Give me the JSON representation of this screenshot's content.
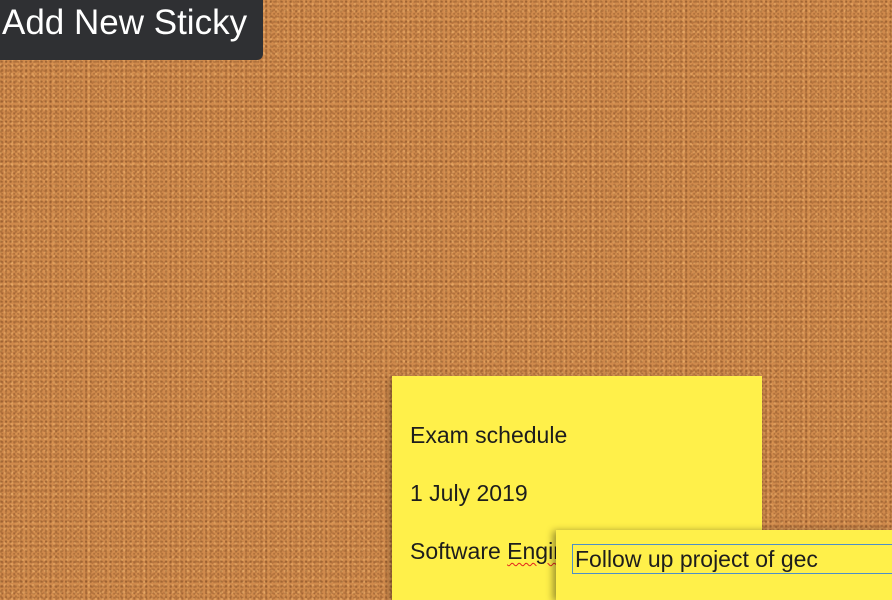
{
  "toolbar": {
    "add_button_label": "Add New Sticky"
  },
  "notes": [
    {
      "lines": [
        "Exam schedule",
        "1 July 2019",
        "Software "
      ],
      "misspelled_word": "Enginner"
    },
    {
      "value": "Follow up project of gec"
    }
  ],
  "colors": {
    "board": "#cf8a4c",
    "sticky": "#fff04a",
    "button_bg": "#2f3033",
    "button_text": "#ffffff",
    "focus_border": "#4d8fc7",
    "spellcheck": "#e2211c"
  }
}
